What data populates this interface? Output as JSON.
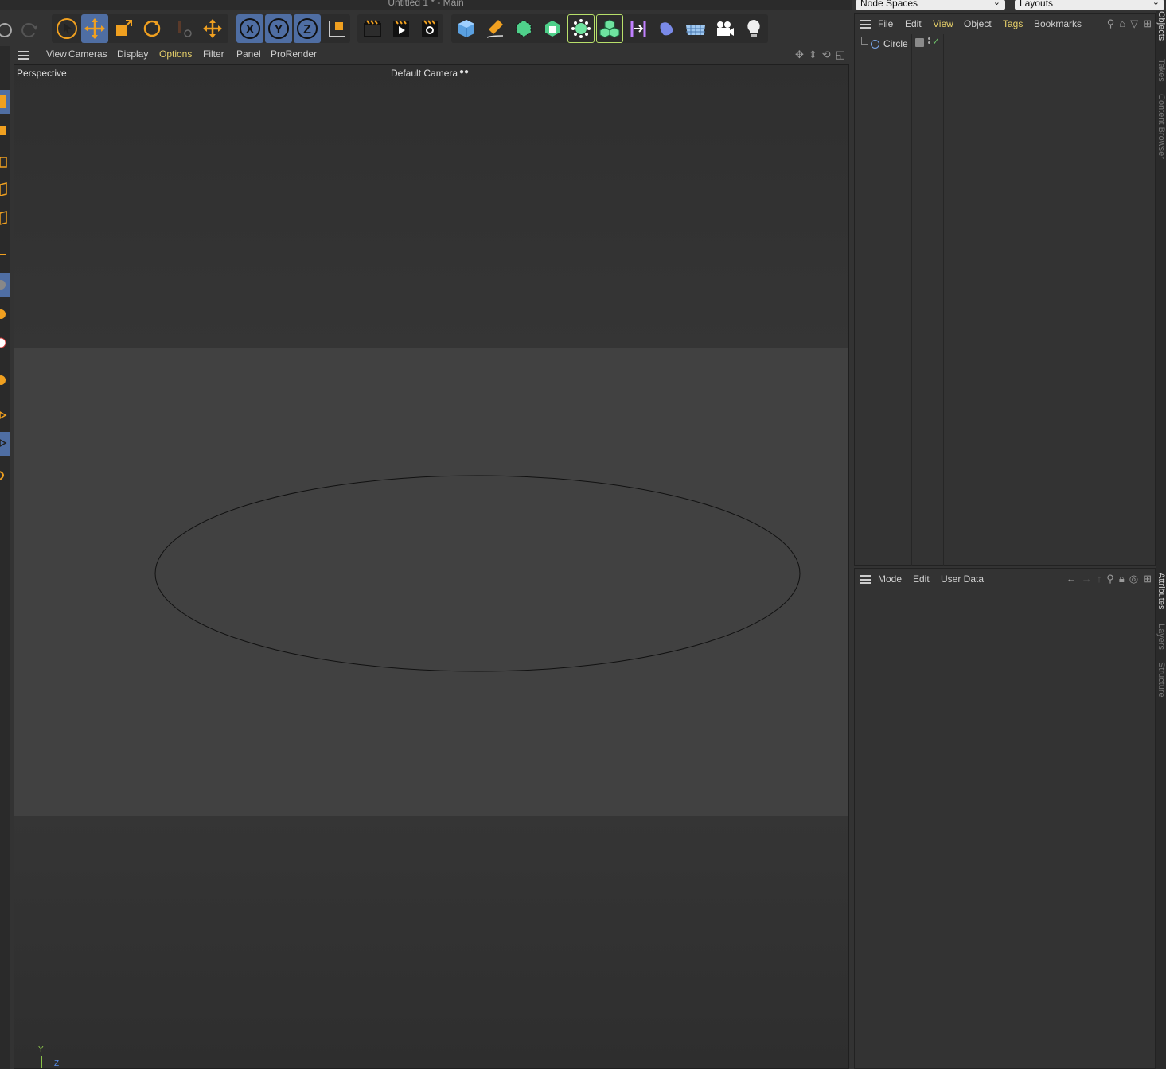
{
  "window": {
    "title": "Untitled 1 * - Main"
  },
  "top_right": {
    "node_spaces": "Node Spaces",
    "layouts": "Layouts"
  },
  "toolbar": {
    "icons": [
      "undo-icon",
      "redo-icon",
      "select-tool-icon",
      "move-tool-icon",
      "scale-tool-icon",
      "rotate-tool-icon",
      "placeholder-tool-icon",
      "transform-tool-icon",
      "x-axis-icon",
      "y-axis-icon",
      "z-axis-icon",
      "coordinate-system-icon",
      "render-region-icon",
      "render-view-icon",
      "render-settings-icon",
      "cube-icon",
      "pen-icon",
      "subdivision-icon",
      "extrude-icon",
      "cloner-icon",
      "mograph-icon",
      "bend-icon",
      "deformer-icon",
      "floor-icon",
      "camera-icon",
      "light-icon"
    ],
    "axis_labels": {
      "x": "X",
      "y": "Y",
      "z": "Z"
    }
  },
  "viewport_menu": {
    "items": [
      "View",
      "Cameras",
      "Display",
      "Options",
      "Filter",
      "Panel",
      "ProRender"
    ],
    "highlighted": "Options"
  },
  "viewport": {
    "projection": "Perspective",
    "camera": "Default Camera",
    "axis": {
      "y": "Y",
      "z": "Z"
    }
  },
  "objects_panel": {
    "menu": [
      "File",
      "Edit",
      "View",
      "Object",
      "Tags",
      "Bookmarks"
    ],
    "objects": [
      {
        "name": "Circle"
      }
    ]
  },
  "attributes_panel": {
    "menu": [
      "Mode",
      "Edit",
      "User Data"
    ]
  },
  "side_tabs": {
    "upper": [
      "Objects",
      "Takes",
      "Content Browser"
    ],
    "lower": [
      "Attributes",
      "Layers",
      "Structure"
    ]
  },
  "colors": {
    "accent_active": "#4f6ea3",
    "menu_highlight": "#e8d16a",
    "brand_orange": "#f0a020",
    "mograph_green": "#6fe3a0"
  }
}
